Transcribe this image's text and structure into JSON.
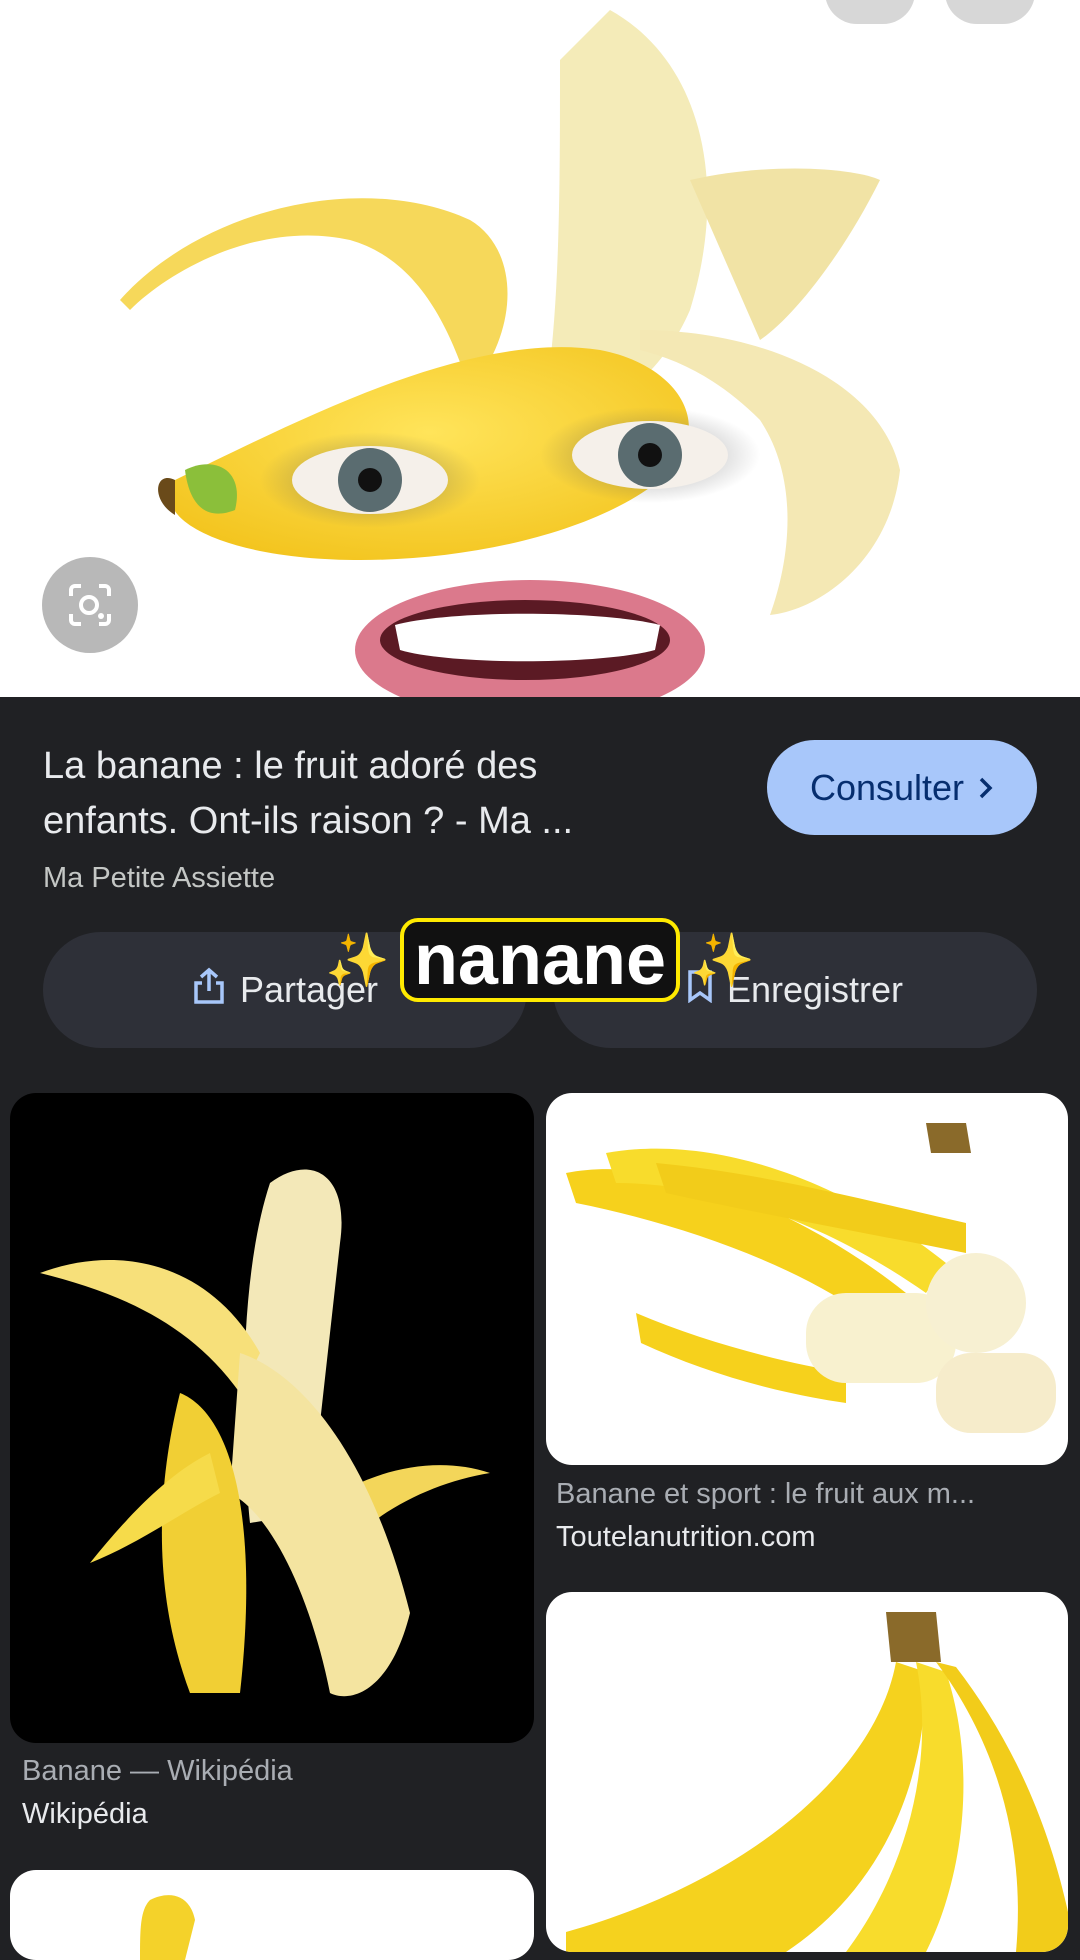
{
  "result": {
    "title": "La banane : le fruit adoré des enfants. Ont-ils raison ? - Ma ...",
    "source": "Ma Petite Assiette",
    "consult_label": "Consulter",
    "share_label": "Partager",
    "save_label": "Enregistrer"
  },
  "caption": {
    "text": "nanane",
    "sparkle": "✨"
  },
  "grid": [
    {
      "subtitle": "Banane — Wikipédia",
      "site": "Wikipédia"
    },
    {
      "subtitle": "Banane et sport : le fruit aux m...",
      "site": "Toutelanutrition.com"
    }
  ],
  "colors": {
    "background": "#202124",
    "accent_button": "#a8c7fa",
    "caption_border": "#ffea00"
  }
}
